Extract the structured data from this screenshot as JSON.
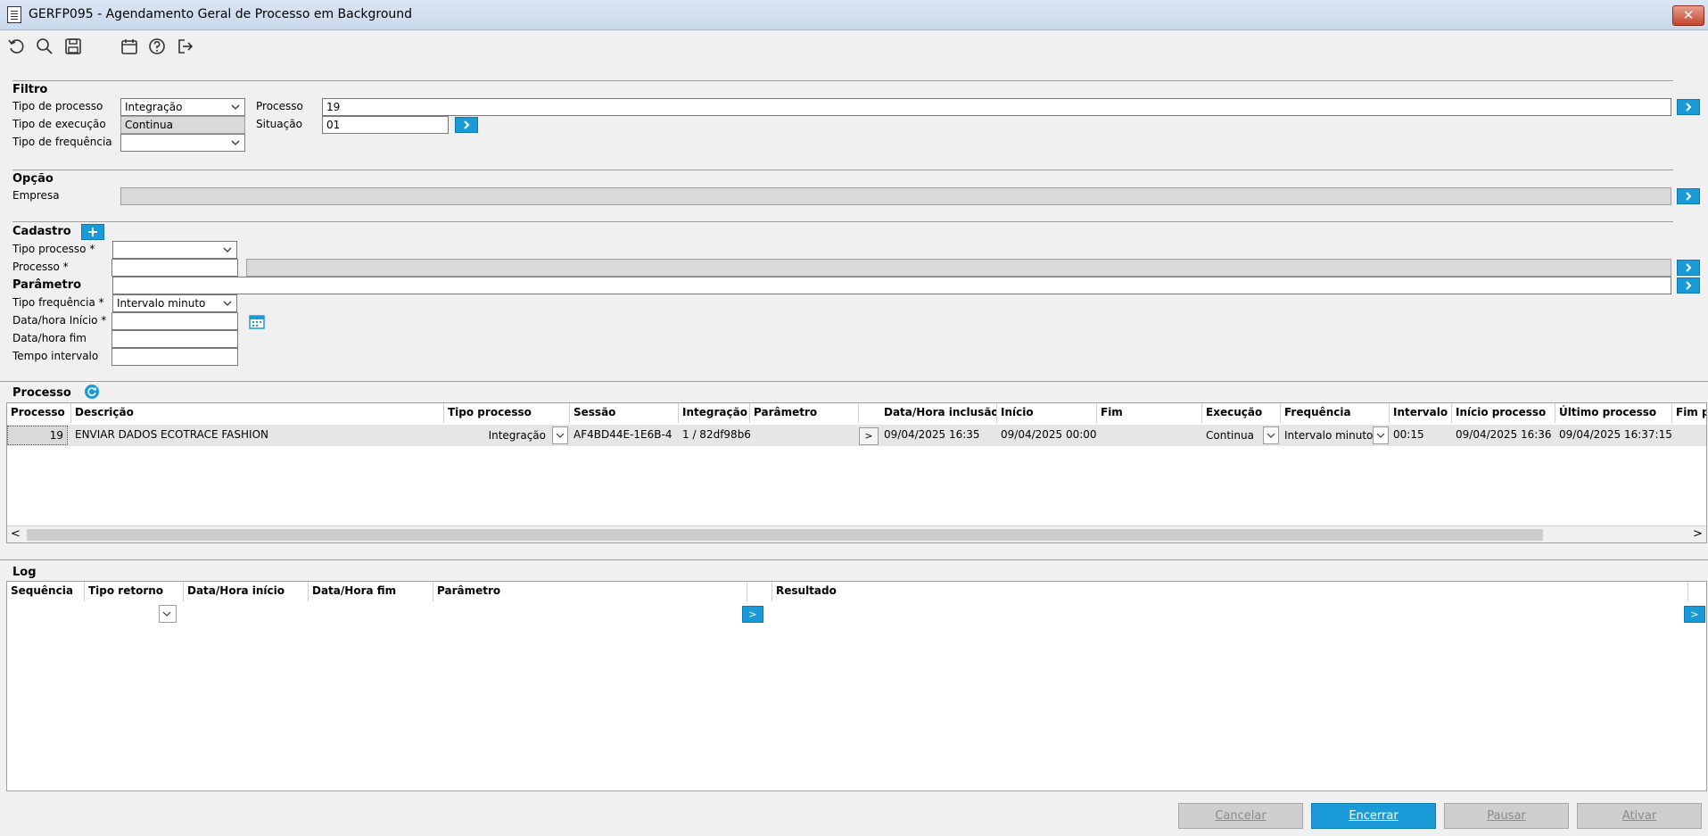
{
  "window": {
    "title": "GERFP095 - Agendamento Geral de Processo em Background",
    "close_glyph": "✕"
  },
  "toolbar": {
    "icons": [
      "undo-icon",
      "search-icon",
      "save-icon",
      "calendar-icon",
      "help-icon",
      "exit-icon"
    ]
  },
  "filtro": {
    "title": "Filtro",
    "tipo_processo_label": "Tipo de processo",
    "tipo_processo_value": "Integração",
    "tipo_execucao_label": "Tipo de execução",
    "tipo_execucao_value": "Continua",
    "tipo_frequencia_label": "Tipo de frequência",
    "tipo_frequencia_value": "",
    "processo_label": "Processo",
    "processo_value": "19",
    "situacao_label": "Situação",
    "situacao_value": "01"
  },
  "opcao": {
    "title": "Opção",
    "empresa_label": "Empresa",
    "empresa_value": ""
  },
  "cadastro": {
    "title": "Cadastro",
    "tipo_processo_label": "Tipo processo *",
    "tipo_processo_value": "",
    "processo_label": "Processo *",
    "processo_value": "",
    "processo_desc": "",
    "parametro_label": "Parâmetro",
    "parametro_value": "",
    "tipo_frequencia_label": "Tipo frequência *",
    "tipo_frequencia_value": "Intervalo minuto",
    "data_inicio_label": "Data/hora Início *",
    "data_inicio_value": "",
    "data_fim_label": "Data/hora fim",
    "data_fim_value": "",
    "tempo_intervalo_label": "Tempo intervalo",
    "tempo_intervalo_value": ""
  },
  "processo_grid": {
    "title": "Processo",
    "headers": {
      "processo": "Processo",
      "descricao": "Descrição",
      "tipo_processo": "Tipo processo",
      "sessao": "Sessão",
      "integracao": "Integração",
      "parametro": "Parâmetro",
      "data_inclusao": "Data/Hora inclusão",
      "inicio": "Início",
      "fim": "Fim",
      "execucao": "Execução",
      "frequencia": "Frequência",
      "intervalo": "Intervalo",
      "inicio_processo": "Início processo",
      "ultimo_processo": "Último processo",
      "fim_processo": "Fim pr"
    },
    "row": {
      "processo": "19",
      "descricao": "ENVIAR DADOS ECOTRACE FASHION",
      "tipo_processo": "Integração",
      "sessao": "AF4BD44E-1E6B-4",
      "integracao": "1 / 82df98b6",
      "parametro": "",
      "param_btn": ">",
      "data_inclusao": "09/04/2025 16:35",
      "inicio": "09/04/2025 00:00",
      "fim": "",
      "execucao": "Continua",
      "frequencia": "Intervalo minuto",
      "intervalo": "00:15",
      "inicio_processo": "09/04/2025 16:36",
      "ultimo_processo": "09/04/2025 16:37:15"
    },
    "scroll_left": "<",
    "scroll_right": ">"
  },
  "log_grid": {
    "title": "Log",
    "headers": {
      "sequencia": "Sequência",
      "tipo_retorno": "Tipo retorno",
      "data_inicio": "Data/Hora início",
      "data_fim": "Data/Hora fim",
      "parametro": "Parâmetro",
      "resultado": "Resultado"
    },
    "param_btn": ">",
    "resultado_btn": ">"
  },
  "footer": {
    "cancelar": "Cancelar",
    "encerrar": "Encerrar",
    "pausar": "Pausar",
    "ativar": "Ativar"
  },
  "colors": {
    "accent": "#1a9bd7",
    "disabled": "#cfcfcf"
  }
}
